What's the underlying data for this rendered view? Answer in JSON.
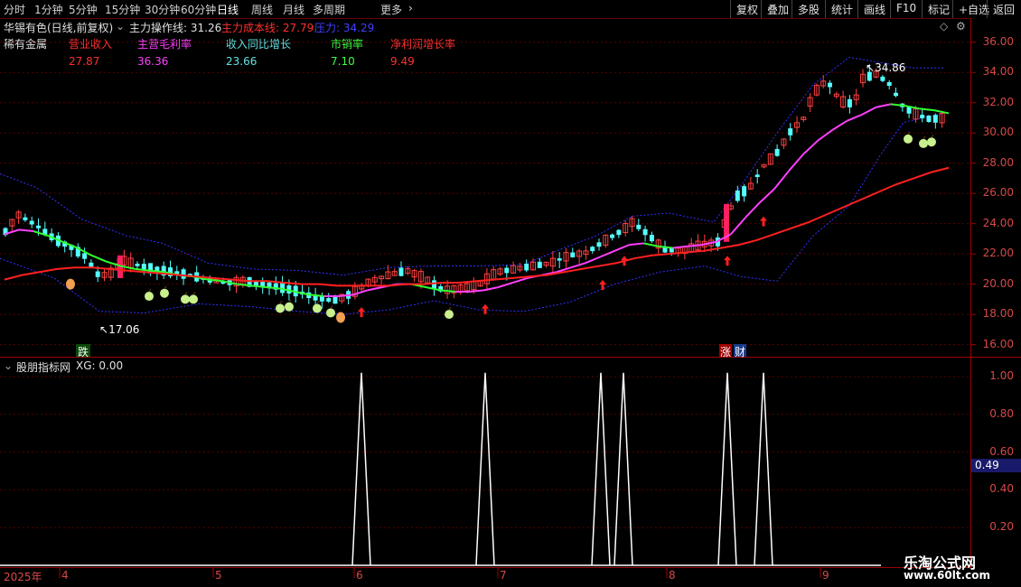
{
  "toolbar": {
    "periods": [
      "分时",
      "1分钟",
      "5分钟",
      "15分钟",
      "30分钟",
      "60分钟",
      "日线",
      "周线",
      "月线",
      "多周期",
      "更多"
    ],
    "active_period": "日线",
    "right_buttons": [
      "复权",
      "叠加",
      "多股",
      "统计",
      "画线",
      "F10",
      "标记",
      "+自选",
      "返回"
    ]
  },
  "main_chart": {
    "stock_title": "华锡有色(日线,前复权)",
    "indicator_name": "主力操作线: 31.26",
    "cost_line": "主力成本线: 27.79",
    "pressure_line": "压力: 34.29",
    "sector": "稀有金属",
    "fundamentals": [
      {
        "label": "营业收入",
        "value": "27.87",
        "color": "#ff3030"
      },
      {
        "label": "主营毛利率",
        "value": "36.36",
        "color": "#ff40ff"
      },
      {
        "label": "收入同比增长",
        "value": "23.66",
        "color": "#60e0e0"
      },
      {
        "label": "市销率",
        "value": "7.10",
        "color": "#40ff40"
      },
      {
        "label": "净利润增长率",
        "value": "9.49",
        "color": "#ff3030"
      }
    ],
    "high_label": "34.86",
    "low_label": "17.06",
    "signal_fall": "跌",
    "signal_rise": "涨",
    "signal_cai": "财"
  },
  "price_axis": {
    "ticks": [
      "36.00",
      "34.00",
      "32.00",
      "30.00",
      "28.00",
      "26.00",
      "24.00",
      "22.00",
      "20.00",
      "18.00",
      "16.00"
    ]
  },
  "sub_chart": {
    "title": "股朋指标网",
    "value_text": "XG: 0.00",
    "ticks": [
      "1.00",
      "0.80",
      "0.60",
      "0.40",
      "0.20"
    ],
    "marker_value": "0.49"
  },
  "time_axis": {
    "labels": [
      "2025年",
      "4",
      "5",
      "6",
      "7",
      "8",
      "9"
    ]
  },
  "watermark": {
    "name": "乐淘公式网",
    "url": "www.60lt.com"
  },
  "chart_data": {
    "type": "candlestick",
    "y_range": [
      15.5,
      37.0
    ],
    "ma_green_pink": [
      23.3,
      23.6,
      23.5,
      23.2,
      22.8,
      22.4,
      21.9,
      21.5,
      21.2,
      21.0,
      20.9,
      20.8,
      20.6,
      20.5,
      20.3,
      20.2,
      20.0,
      19.9,
      19.8,
      19.7,
      19.5,
      19.3,
      19.2,
      19.2,
      19.3,
      19.6,
      19.8,
      20.0,
      20.0,
      19.8,
      19.6,
      19.5,
      19.5,
      19.6,
      19.8,
      20.1,
      20.4,
      20.6,
      20.8,
      21.1,
      21.4,
      21.8,
      22.2,
      22.6,
      22.7,
      22.5,
      22.4,
      22.5,
      22.6,
      22.8,
      23.3,
      24.4,
      25.4,
      26.3,
      27.5,
      28.6,
      29.5,
      30.2,
      30.8,
      31.2,
      31.7,
      31.9,
      31.8,
      31.6,
      31.5,
      31.3
    ],
    "ma_red": [
      20.3,
      20.6,
      20.8,
      21.0,
      21.1,
      21.1,
      21.0,
      20.9,
      20.8,
      20.7,
      20.6,
      20.5,
      20.4,
      20.3,
      20.2,
      20.2,
      20.1,
      20.0,
      20.0,
      19.9,
      19.9,
      19.9,
      19.9,
      20.0,
      20.0,
      20.1,
      20.1,
      20.2,
      20.3,
      20.4,
      20.5,
      20.6,
      20.8,
      21.0,
      21.2,
      21.4,
      21.7,
      21.9,
      22.0,
      22.1,
      22.2,
      22.4,
      22.6,
      22.9,
      23.3,
      23.7,
      24.1,
      24.6,
      25.1,
      25.6,
      26.1,
      26.6,
      27.0,
      27.4,
      27.7
    ],
    "sub_peaks_x": [
      400,
      537,
      665,
      690,
      805,
      845
    ]
  }
}
